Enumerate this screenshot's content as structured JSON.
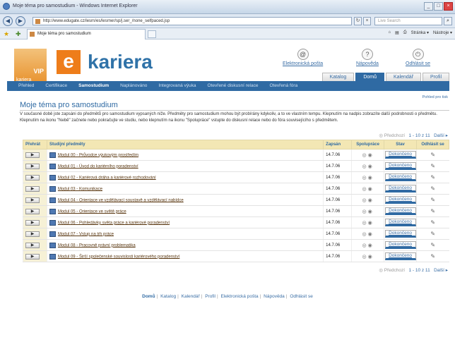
{
  "window": {
    "title": "Moje téma pro samostudium - Windows Internet Explorer"
  },
  "addressbar": {
    "url": "http://www.edugate.cz/lesrn/es/lesrner/sp/j.ser_/none_selfpaced.jsp",
    "search_placeholder": "Live Search"
  },
  "tabbar": {
    "tab_label": "Moje téma pro samostudium",
    "commands": [
      "Stránka ▾",
      "Nástroje ▾"
    ]
  },
  "header": {
    "logo_vip": "VIP",
    "logo_vip_sub": "kariera",
    "logo_e": "e",
    "logo_kariera": "kariera",
    "util": [
      "Elektronická pošta",
      "Nápověda",
      "Odhlásit se"
    ],
    "main_tabs": [
      {
        "label": "Katalog",
        "active": false
      },
      {
        "label": "Domů",
        "active": true
      },
      {
        "label": "Kalendář",
        "active": false
      },
      {
        "label": "Profil",
        "active": false
      }
    ],
    "sub_nav": [
      "Přehled",
      "Certifikace",
      "Samostudium",
      "Naplánováno",
      "Integrovaná výuka",
      "Otevřené diskusní relace",
      "Otevřená fóra"
    ]
  },
  "main": {
    "print_label": "Pohled pro tisk",
    "title": "Moje téma pro samostudium",
    "intro": "V současné době jste zapsáni do předmětů pro samostudium vypsaných níže. Předměty pro samostudium mohou být probírány kdykoliv, a to ve vlastním tempu. Klepnutím na nadpis zobrazíte další podrobnosti o předmětu. Klepnutím na ikonu \"Nebě\" začnete nebo pokračujte ve studiu, nebo klepnutím na ikonu \"Spolupráce\" vstupte do diskusní relace nebo do fóra souvisejícího s předmětem.",
    "pager": {
      "prev": "◎ Předchozí",
      "range": "1 - 10 z 11",
      "next": "Další ▸"
    },
    "columns": [
      "Přehrát",
      "Studijní předměty",
      "Zapsán",
      "Spolupráce",
      "Stav",
      "Odhlásit se"
    ],
    "rows": [
      {
        "title": "Modul 00 - Průvodce výukovým prostředím",
        "date": "14.7.06",
        "status": "Dokončeno"
      },
      {
        "title": "Modul 01 - Úvod do kariérního poradenství",
        "date": "14.7.06",
        "status": "Dokončeno"
      },
      {
        "title": "Modul 02 - Kariérová dráha a kariérové rozhodování",
        "date": "14.7.06",
        "status": "Dokončeno"
      },
      {
        "title": "Modul 03 - Komunikace",
        "date": "14.7.06",
        "status": "Dokončeno"
      },
      {
        "title": "Modul 04 - Orientace ve vzdělávací soustavě a vzdělávací nabídce",
        "date": "14.7.06",
        "status": "Dokončeno"
      },
      {
        "title": "Modul 05 - Orientace ve světě práce",
        "date": "14.7.06",
        "status": "Dokončeno"
      },
      {
        "title": "Modul 06 - Pohledávky světa práce a kariérové poradenství",
        "date": "14.7.06",
        "status": "Dokončeno"
      },
      {
        "title": "Modul 07 - Vstup na trh práce",
        "date": "14.7.06",
        "status": "Dokončeno"
      },
      {
        "title": "Modul 08 - Pracovně právní problematika",
        "date": "14.7.06",
        "status": "Dokončeno"
      },
      {
        "title": "Modul 09 - Širší společenské souvislosti kariérového poradenství",
        "date": "14.7.06",
        "status": "Dokončeno"
      }
    ],
    "play_label": "▶"
  },
  "footer": {
    "links": [
      "Domů",
      "Katalog",
      "Kalendář",
      "Profil",
      "Elektronická pošta",
      "Nápověda",
      "Odhlásit se"
    ]
  }
}
